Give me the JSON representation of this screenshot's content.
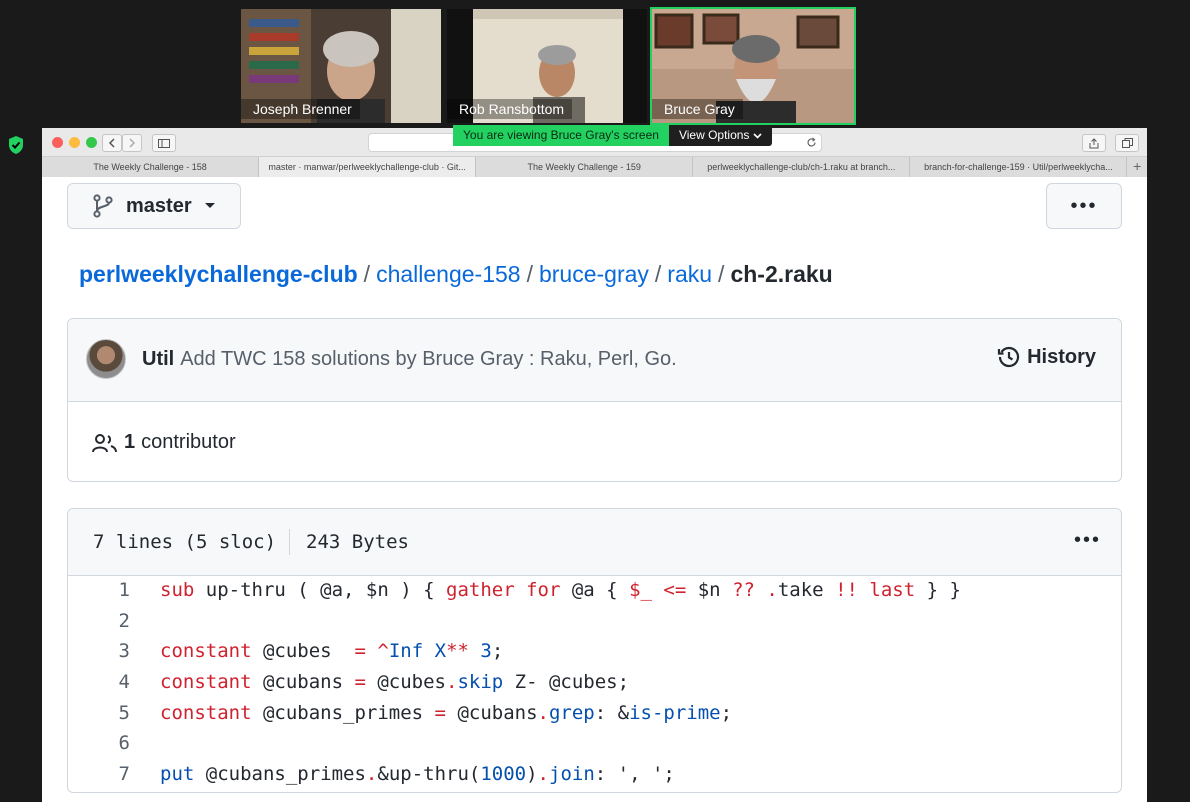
{
  "participants": [
    {
      "name": "Joseph Brenner"
    },
    {
      "name": "Rob Ransbottom"
    },
    {
      "name": "Bruce Gray",
      "active": true
    }
  ],
  "share_banner": {
    "viewing": "You are viewing Bruce Gray's screen",
    "options": "View Options"
  },
  "colors": {
    "active_speaker": "#23d160",
    "link": "#0969da",
    "keyword": "#cf222e",
    "builtin": "#0550ae"
  },
  "browser": {
    "tabs": [
      {
        "title": "The Weekly Challenge - 158"
      },
      {
        "title": "master · manwar/perlweeklychallenge-club · Git..."
      },
      {
        "title": "The Weekly Challenge - 159"
      },
      {
        "title": "perlweeklychallenge-club/ch-1.raku at branch..."
      },
      {
        "title": "branch-for-challenge-159 · Util/perlweeklycha..."
      }
    ]
  },
  "github": {
    "branch": "master",
    "breadcrumb": {
      "repo": "perlweeklychallenge-club",
      "dir1": "challenge-158",
      "dir2": "bruce-gray",
      "dir3": "raku",
      "file": "ch-2.raku",
      "sep": "/"
    },
    "commit": {
      "author": "Util",
      "message": "Add TWC 158 solutions by Bruce Gray : Raku, Perl, Go.",
      "history_label": "History"
    },
    "contributors": {
      "count": "1",
      "label": "contributor"
    },
    "file": {
      "lines": "7 lines (5 sloc)",
      "size": "243 Bytes",
      "code": [
        {
          "n": "1",
          "parts": [
            {
              "t": "sub",
              "c": "kw"
            },
            {
              "t": " up-thru ( @a, $n ) { "
            },
            {
              "t": "gather",
              "c": "kw"
            },
            {
              "t": " "
            },
            {
              "t": "for",
              "c": "kw"
            },
            {
              "t": " @a { "
            },
            {
              "t": "$_",
              "c": "kw"
            },
            {
              "t": " "
            },
            {
              "t": "<=",
              "c": "kw"
            },
            {
              "t": " $n "
            },
            {
              "t": "??",
              "c": "kw"
            },
            {
              "t": " "
            },
            {
              "t": ".",
              "c": "kw"
            },
            {
              "t": "take "
            },
            {
              "t": "!!",
              "c": "kw"
            },
            {
              "t": " "
            },
            {
              "t": "last",
              "c": "kw"
            },
            {
              "t": " } }"
            }
          ]
        },
        {
          "n": "2",
          "parts": []
        },
        {
          "n": "3",
          "parts": [
            {
              "t": "constant",
              "c": "kw"
            },
            {
              "t": " @cubes  "
            },
            {
              "t": "=",
              "c": "kw"
            },
            {
              "t": " "
            },
            {
              "t": "^",
              "c": "kw"
            },
            {
              "t": "Inf",
              "c": "fn"
            },
            {
              "t": " "
            },
            {
              "t": "X",
              "c": "fn"
            },
            {
              "t": "**",
              "c": "kw"
            },
            {
              "t": " "
            },
            {
              "t": "3",
              "c": "fn"
            },
            {
              "t": ";"
            }
          ]
        },
        {
          "n": "4",
          "parts": [
            {
              "t": "constant",
              "c": "kw"
            },
            {
              "t": " @cubans "
            },
            {
              "t": "=",
              "c": "kw"
            },
            {
              "t": " @cubes"
            },
            {
              "t": ".",
              "c": "kw"
            },
            {
              "t": "skip",
              "c": "fn"
            },
            {
              "t": " Z- @cubes;"
            }
          ]
        },
        {
          "n": "5",
          "parts": [
            {
              "t": "constant",
              "c": "kw"
            },
            {
              "t": " @cubans_primes "
            },
            {
              "t": "=",
              "c": "kw"
            },
            {
              "t": " @cubans"
            },
            {
              "t": ".",
              "c": "kw"
            },
            {
              "t": "grep",
              "c": "fn"
            },
            {
              "t": ": &"
            },
            {
              "t": "is-prime",
              "c": "fn"
            },
            {
              "t": ";"
            }
          ]
        },
        {
          "n": "6",
          "parts": []
        },
        {
          "n": "7",
          "parts": [
            {
              "t": "put",
              "c": "fn"
            },
            {
              "t": " @cubans_primes"
            },
            {
              "t": ".",
              "c": "kw"
            },
            {
              "t": "&up-thru("
            },
            {
              "t": "1000",
              "c": "fn"
            },
            {
              "t": ")"
            },
            {
              "t": ".",
              "c": "kw"
            },
            {
              "t": "join",
              "c": "fn"
            },
            {
              "t": ": ', ';"
            }
          ]
        }
      ]
    }
  }
}
